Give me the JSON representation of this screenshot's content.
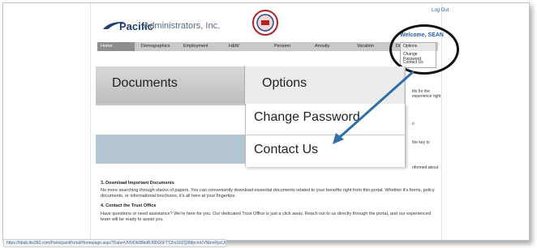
{
  "header": {
    "logout": "Log Out",
    "logo_bold": "Pacific",
    "logo_light": "Administrators, Inc.",
    "welcome": "Welcome, SEAN"
  },
  "nav": {
    "items": [
      "Home",
      "Demographics",
      "Employment",
      "H&W",
      "Pension",
      "Annuity",
      "Vacation",
      "Documents"
    ]
  },
  "options_dropdown_small": [
    "Options",
    "Change Password",
    "Contact Us"
  ],
  "zoom": {
    "tab_documents": "Documents",
    "tab_options": "Options",
    "menu": [
      "Change Password",
      "Contact Us"
    ]
  },
  "side_snippets": {
    "s1": "tits for the",
    "s2": "experience right",
    "s3": "o",
    "s4": "the key to",
    "s5": "nformed about"
  },
  "sections": {
    "s3_title": "3. Download Important Documents",
    "s3_body": "No more searching through stacks of papers. You can conveniently download essential documents related to your benefits right from this portal. Whether it's forms, policy documents, or informational brochures, it's all here at your fingertips.",
    "s4_title": "4. Contact the Trust Office",
    "s4_body": "Have questions or need assistance? We're here for you. Our dedicated Trust Office is just a click away. Reach out to us directly through the portal, and our experienced team will be ready to assist you."
  },
  "status_url": "https://hbab.ibs360.com/ParticipantPortal/Homepage.aspx?Data=UVNOb0BkdRJ9DG5FTTZmS0ZQ0MpcmUVNbmRpcUQRdLI1OTRLbl HQeWaptkaw%3d#",
  "colors": {
    "brand_navy": "#1f3f6e",
    "link_blue": "#2d5ea8",
    "arrow_blue": "#2f6fa8",
    "band_blue": "#b4c6d2"
  }
}
